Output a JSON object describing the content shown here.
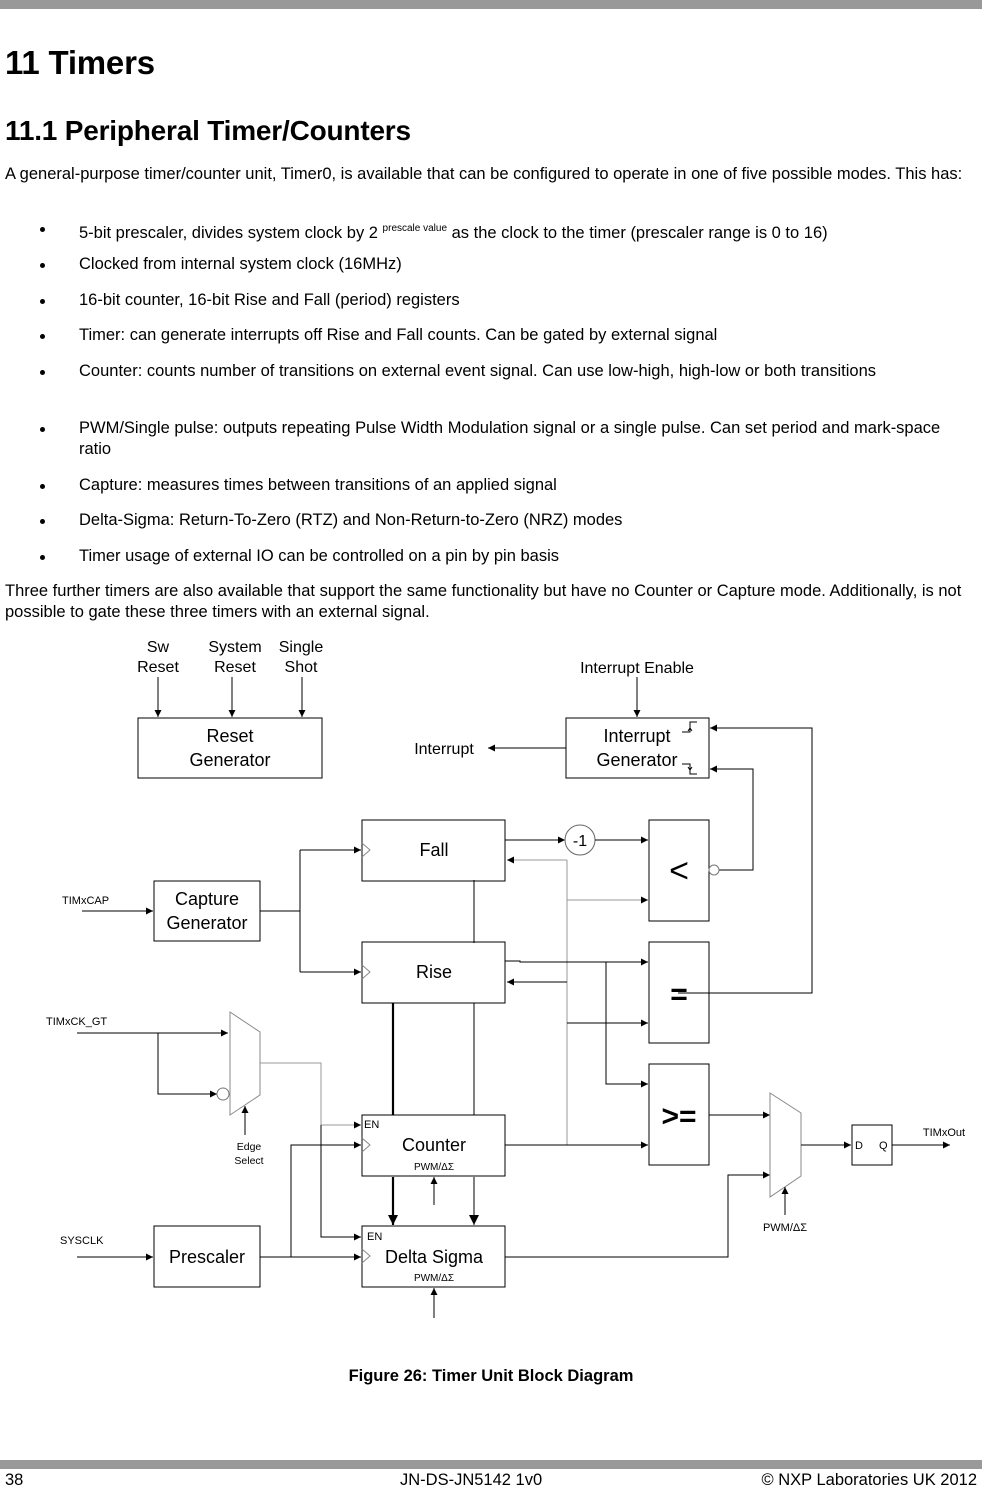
{
  "page": {
    "chapter_title": "11 Timers",
    "section_title": "11.1 Peripheral Timer/Counters",
    "intro": "A general-purpose timer/counter unit, Timer0, is available that can be configured to operate in one of five possible modes.  This has:",
    "bullets": [
      {
        "text": "5-bit prescaler, divides system clock by 2 ",
        "sup": "prescale value",
        "tail": " as the clock to the timer (prescaler range is 0 to 16)"
      },
      {
        "text": "Clocked from internal system clock (16MHz)"
      },
      {
        "text": "16-bit counter, 16-bit Rise and Fall (period) registers"
      },
      {
        "text": "Timer: can generate interrupts off Rise and Fall counts.  Can be gated by external signal"
      },
      {
        "text": "Counter: counts number of transitions on external event signal.  Can use low-high, high-low or both transitions"
      },
      {
        "text": "PWM/Single pulse: outputs repeating Pulse Width Modulation signal or a single pulse.  Can set period and mark-space ratio"
      },
      {
        "text": "Capture: measures times between transitions of an applied signal"
      },
      {
        "text": "Delta-Sigma: Return-To-Zero (RTZ) and Non-Return-to-Zero (NRZ) modes"
      },
      {
        "text": "Timer usage of external IO can be controlled on a pin by pin basis"
      }
    ],
    "closing": "Three further timers are also available that support the same functionality but have no Counter or Capture mode.  Additionally, is not possible to gate these three timers with an external signal."
  },
  "diagram": {
    "inputs": {
      "sw_reset": [
        "Sw",
        "Reset"
      ],
      "system_reset": [
        "System",
        "Reset"
      ],
      "single_shot": [
        "Single",
        "Shot"
      ],
      "interrupt_enable": "Interrupt Enable",
      "timxcap": "TIMxCAP",
      "timxck_gt": "TIMxCK_GT",
      "sysclk": "SYSCLK",
      "edge_select": [
        "Edge",
        "Select"
      ],
      "pwm_ds_select": "PWM/ΔΣ"
    },
    "outputs": {
      "interrupt": "Interrupt",
      "timxout": "TIMxOut"
    },
    "blocks": {
      "reset_generator": [
        "Reset",
        "Generator"
      ],
      "interrupt_generator": [
        "Interrupt",
        "Generator"
      ],
      "capture_generator": [
        "Capture",
        "Generator"
      ],
      "fall": "Fall",
      "rise": "Rise",
      "counter": "Counter",
      "delta_sigma": "Delta Sigma",
      "prescaler": "Prescaler",
      "decrement": "-1",
      "less_than": "<",
      "equal": "=",
      "greater_equal": ">=",
      "flipflop_d": "D",
      "flipflop_q": "Q",
      "en_label": "EN",
      "pwm_ds_label": "PWM/ΔΣ"
    }
  },
  "caption": "Figure 26: Timer Unit Block Diagram",
  "footer": {
    "page_number": "38",
    "doc_id": "JN-DS-JN5142 1v0",
    "copyright": "© NXP Laboratories UK 2012"
  }
}
